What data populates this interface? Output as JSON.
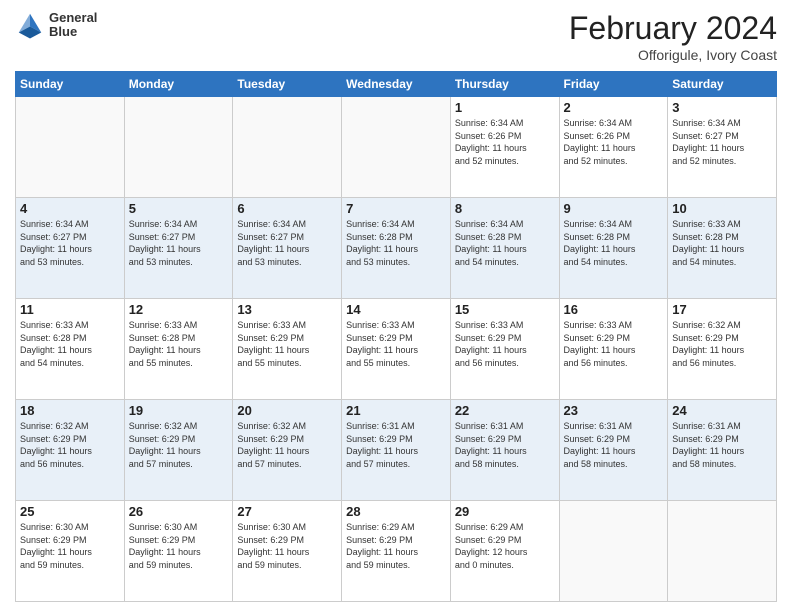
{
  "header": {
    "logo_line1": "General",
    "logo_line2": "Blue",
    "month_title": "February 2024",
    "location": "Offorigule, Ivory Coast"
  },
  "days_of_week": [
    "Sunday",
    "Monday",
    "Tuesday",
    "Wednesday",
    "Thursday",
    "Friday",
    "Saturday"
  ],
  "weeks": [
    [
      {
        "day": "",
        "info": ""
      },
      {
        "day": "",
        "info": ""
      },
      {
        "day": "",
        "info": ""
      },
      {
        "day": "",
        "info": ""
      },
      {
        "day": "1",
        "info": "Sunrise: 6:34 AM\nSunset: 6:26 PM\nDaylight: 11 hours\nand 52 minutes."
      },
      {
        "day": "2",
        "info": "Sunrise: 6:34 AM\nSunset: 6:26 PM\nDaylight: 11 hours\nand 52 minutes."
      },
      {
        "day": "3",
        "info": "Sunrise: 6:34 AM\nSunset: 6:27 PM\nDaylight: 11 hours\nand 52 minutes."
      }
    ],
    [
      {
        "day": "4",
        "info": "Sunrise: 6:34 AM\nSunset: 6:27 PM\nDaylight: 11 hours\nand 53 minutes."
      },
      {
        "day": "5",
        "info": "Sunrise: 6:34 AM\nSunset: 6:27 PM\nDaylight: 11 hours\nand 53 minutes."
      },
      {
        "day": "6",
        "info": "Sunrise: 6:34 AM\nSunset: 6:27 PM\nDaylight: 11 hours\nand 53 minutes."
      },
      {
        "day": "7",
        "info": "Sunrise: 6:34 AM\nSunset: 6:28 PM\nDaylight: 11 hours\nand 53 minutes."
      },
      {
        "day": "8",
        "info": "Sunrise: 6:34 AM\nSunset: 6:28 PM\nDaylight: 11 hours\nand 54 minutes."
      },
      {
        "day": "9",
        "info": "Sunrise: 6:34 AM\nSunset: 6:28 PM\nDaylight: 11 hours\nand 54 minutes."
      },
      {
        "day": "10",
        "info": "Sunrise: 6:33 AM\nSunset: 6:28 PM\nDaylight: 11 hours\nand 54 minutes."
      }
    ],
    [
      {
        "day": "11",
        "info": "Sunrise: 6:33 AM\nSunset: 6:28 PM\nDaylight: 11 hours\nand 54 minutes."
      },
      {
        "day": "12",
        "info": "Sunrise: 6:33 AM\nSunset: 6:28 PM\nDaylight: 11 hours\nand 55 minutes."
      },
      {
        "day": "13",
        "info": "Sunrise: 6:33 AM\nSunset: 6:29 PM\nDaylight: 11 hours\nand 55 minutes."
      },
      {
        "day": "14",
        "info": "Sunrise: 6:33 AM\nSunset: 6:29 PM\nDaylight: 11 hours\nand 55 minutes."
      },
      {
        "day": "15",
        "info": "Sunrise: 6:33 AM\nSunset: 6:29 PM\nDaylight: 11 hours\nand 56 minutes."
      },
      {
        "day": "16",
        "info": "Sunrise: 6:33 AM\nSunset: 6:29 PM\nDaylight: 11 hours\nand 56 minutes."
      },
      {
        "day": "17",
        "info": "Sunrise: 6:32 AM\nSunset: 6:29 PM\nDaylight: 11 hours\nand 56 minutes."
      }
    ],
    [
      {
        "day": "18",
        "info": "Sunrise: 6:32 AM\nSunset: 6:29 PM\nDaylight: 11 hours\nand 56 minutes."
      },
      {
        "day": "19",
        "info": "Sunrise: 6:32 AM\nSunset: 6:29 PM\nDaylight: 11 hours\nand 57 minutes."
      },
      {
        "day": "20",
        "info": "Sunrise: 6:32 AM\nSunset: 6:29 PM\nDaylight: 11 hours\nand 57 minutes."
      },
      {
        "day": "21",
        "info": "Sunrise: 6:31 AM\nSunset: 6:29 PM\nDaylight: 11 hours\nand 57 minutes."
      },
      {
        "day": "22",
        "info": "Sunrise: 6:31 AM\nSunset: 6:29 PM\nDaylight: 11 hours\nand 58 minutes."
      },
      {
        "day": "23",
        "info": "Sunrise: 6:31 AM\nSunset: 6:29 PM\nDaylight: 11 hours\nand 58 minutes."
      },
      {
        "day": "24",
        "info": "Sunrise: 6:31 AM\nSunset: 6:29 PM\nDaylight: 11 hours\nand 58 minutes."
      }
    ],
    [
      {
        "day": "25",
        "info": "Sunrise: 6:30 AM\nSunset: 6:29 PM\nDaylight: 11 hours\nand 59 minutes."
      },
      {
        "day": "26",
        "info": "Sunrise: 6:30 AM\nSunset: 6:29 PM\nDaylight: 11 hours\nand 59 minutes."
      },
      {
        "day": "27",
        "info": "Sunrise: 6:30 AM\nSunset: 6:29 PM\nDaylight: 11 hours\nand 59 minutes."
      },
      {
        "day": "28",
        "info": "Sunrise: 6:29 AM\nSunset: 6:29 PM\nDaylight: 11 hours\nand 59 minutes."
      },
      {
        "day": "29",
        "info": "Sunrise: 6:29 AM\nSunset: 6:29 PM\nDaylight: 12 hours\nand 0 minutes."
      },
      {
        "day": "",
        "info": ""
      },
      {
        "day": "",
        "info": ""
      }
    ]
  ]
}
